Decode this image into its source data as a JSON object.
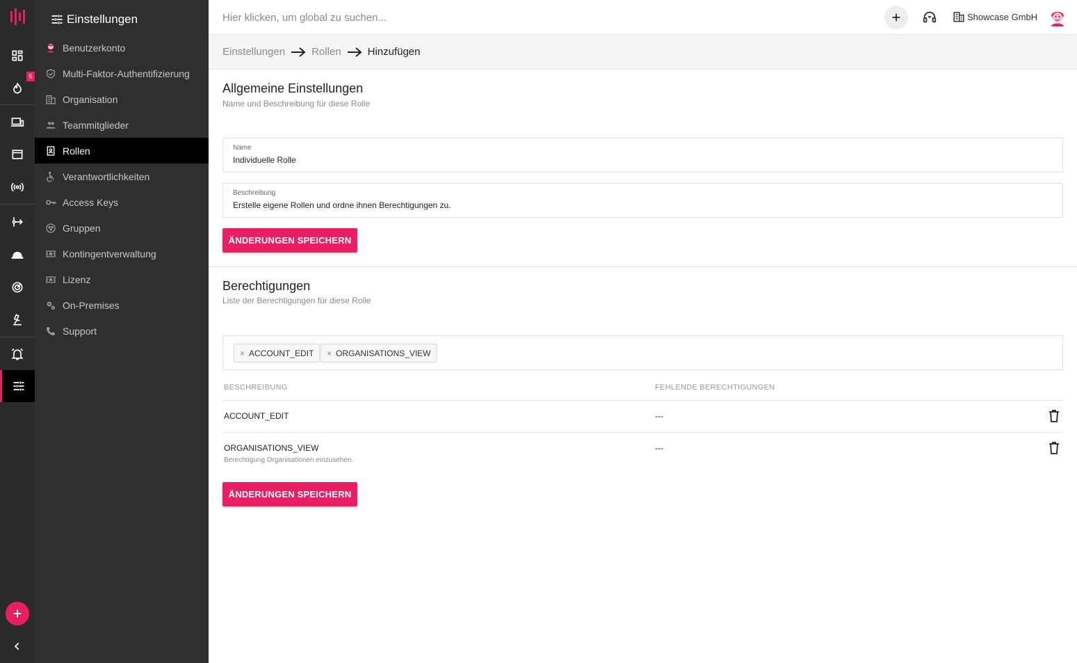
{
  "rail": {
    "badge_count": "5",
    "items": [
      "dashboard-icon",
      "fire-icon",
      "devices-icon",
      "window-icon",
      "broadcast-icon",
      "flow-icon",
      "hardhat-icon",
      "radar-icon",
      "microscope-icon",
      "alarm-icon",
      "settings-sliders-icon"
    ],
    "accent": "#e91e63"
  },
  "sidebar": {
    "title": "Einstellungen",
    "items": [
      {
        "label": "Benutzerkonto",
        "icon": "avatar-icon"
      },
      {
        "label": "Multi-Faktor-Authentifizierung",
        "icon": "shield-check-icon"
      },
      {
        "label": "Organisation",
        "icon": "building-icon"
      },
      {
        "label": "Teammitglieder",
        "icon": "people-icon"
      },
      {
        "label": "Rollen",
        "icon": "badge-icon"
      },
      {
        "label": "Verantwortlichkeiten",
        "icon": "accessibility-icon"
      },
      {
        "label": "Access Keys",
        "icon": "key-icon"
      },
      {
        "label": "Gruppen",
        "icon": "group-circle-icon"
      },
      {
        "label": "Kontingentverwaltung",
        "icon": "ticket-icon"
      },
      {
        "label": "Lizenz",
        "icon": "license-icon"
      },
      {
        "label": "On-Premises",
        "icon": "gears-icon"
      },
      {
        "label": "Support",
        "icon": "phone-icon"
      }
    ]
  },
  "topbar": {
    "search_placeholder": "Hier klicken, um global zu suchen...",
    "org_name": "Showcase GmbH"
  },
  "breadcrumb": {
    "items": [
      "Einstellungen",
      "Rollen",
      "Hinzufügen"
    ]
  },
  "general": {
    "title": "Allgemeine Einstellungen",
    "subtitle": "Name und Beschreibung für diese Rolle",
    "name_label": "Name",
    "name_value": "Individuelle Rolle",
    "description_label": "Beschreibung",
    "description_value": "Erstelle eigene Rollen und ordne ihnen Berechtigungen zu.",
    "save_label": "ÄNDERUNGEN SPEICHERN"
  },
  "permissions": {
    "title": "Berechtigungen",
    "subtitle": "Liste der Berechtigungen für diese Rolle",
    "chips": [
      "ACCOUNT_EDIT",
      "ORGANISATIONS_VIEW"
    ],
    "chip_remove": "×",
    "columns": [
      "BESCHREIBUNG",
      "FEHLENDE BERECHTIGUNGEN"
    ],
    "rows": [
      {
        "name": "ACCOUNT_EDIT",
        "description": "",
        "missing": "---"
      },
      {
        "name": "ORGANISATIONS_VIEW",
        "description": "Berechtigung Organisationen einzusehen.",
        "missing": "---"
      }
    ],
    "save_label": "ÄNDERUNGEN SPEICHERN"
  }
}
